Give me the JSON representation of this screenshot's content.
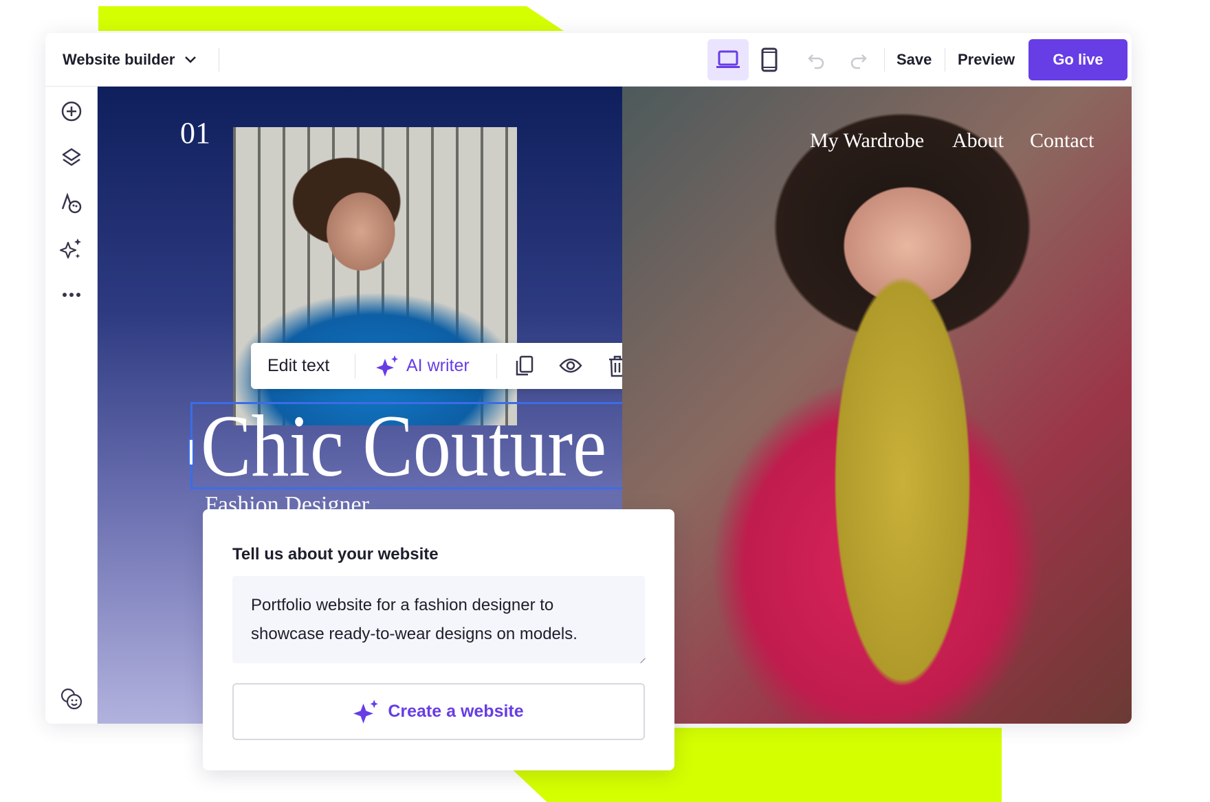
{
  "colors": {
    "accent": "#673de6",
    "highlight": "#d4ff00",
    "selection": "#3b6de6"
  },
  "topbar": {
    "app_title": "Website builder",
    "save": "Save",
    "preview": "Preview",
    "go_live": "Go live",
    "icons": [
      "chevron-down-icon",
      "laptop-icon",
      "mobile-icon",
      "undo-icon",
      "redo-icon"
    ]
  },
  "sidebar": {
    "icons": [
      "add-icon",
      "layers-icon",
      "styles-icon",
      "ai-sparkle-icon",
      "more-icon",
      "help-faces-icon"
    ]
  },
  "site": {
    "section_number": "01",
    "title": "Chic Couture",
    "subtitle": "Fashion Designer",
    "nav": [
      "My Wardrobe",
      "About",
      "Contact"
    ]
  },
  "edit_toolbar": {
    "edit_text": "Edit text",
    "ai_writer": "AI writer",
    "icons": [
      "sparkle-icon",
      "duplicate-icon",
      "eye-icon",
      "trash-icon"
    ]
  },
  "ai_card": {
    "heading": "Tell us about your website",
    "description": "Portfolio website for a fashion designer to showcase ready-to-wear designs on models.",
    "create_button": "Create a website"
  }
}
